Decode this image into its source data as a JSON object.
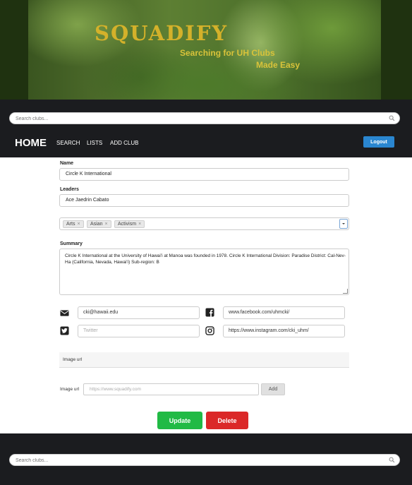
{
  "banner": {
    "title": "SQUADIFY",
    "tagline_line1": "Searching for UH Clubs",
    "tagline_line2": "Made Easy"
  },
  "search": {
    "placeholder": "Search clubs..."
  },
  "navbar": {
    "home": "HOME",
    "links": [
      "SEARCH",
      "LISTS",
      "ADD CLUB"
    ],
    "logout": "Logout"
  },
  "form": {
    "name_label": "Name",
    "name_value": "Circle K International",
    "leaders_label": "Leaders",
    "leaders_value": "Ace Jaedrin Cabato",
    "tags": [
      "Arts",
      "Asian",
      "Activism"
    ],
    "summary_label": "Summary",
    "summary_value": "Circle K International at the University of Hawai'i at Manoa was founded in 1978. Circle K International Division: Paradise District: Cal-Nev-Ha (California, Nevada, Hawai'i) Sub-region: B",
    "email_value": "cki@hawaii.edu",
    "facebook_value": "www.facebook.com/uhmcki/",
    "twitter_placeholder": "Twitter",
    "instagram_value": "https://www.instagram.com/cki_uhm/",
    "image_section_label": "Image url",
    "image_url_label": "Image url",
    "image_url_placeholder": "https://www.squadify.com",
    "add_label": "Add",
    "update_label": "Update",
    "delete_label": "Delete"
  },
  "colors": {
    "logo": "#d4b12a",
    "update": "#21ba45",
    "delete": "#db2828",
    "logout": "#2a86d0",
    "nav_bg": "#1b1c1f"
  }
}
